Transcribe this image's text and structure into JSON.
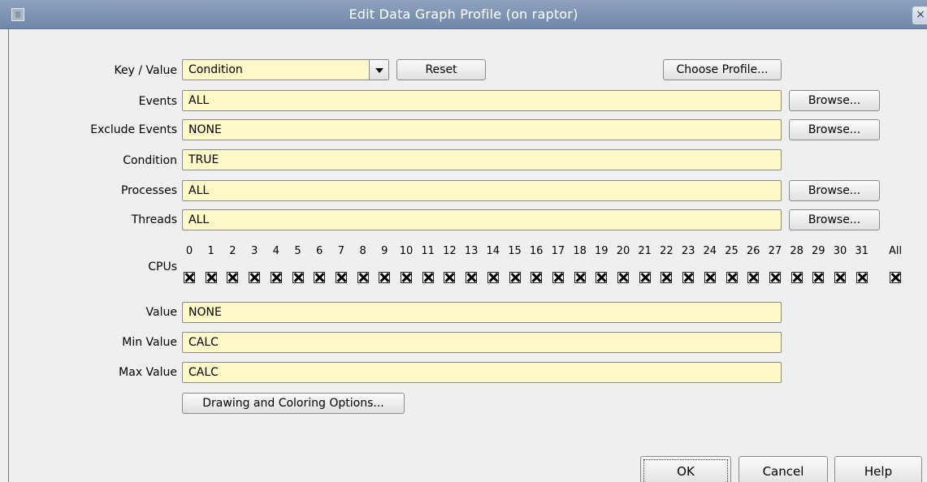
{
  "window": {
    "title": "Edit Data Graph Profile (on raptor)",
    "close_glyph": "×"
  },
  "form": {
    "key_value": {
      "label": "Key / Value",
      "selected": "Condition"
    },
    "reset_label": "Reset",
    "choose_profile_label": "Choose Profile...",
    "events": {
      "label": "Events",
      "value": "ALL",
      "browse_label": "Browse..."
    },
    "exclude_events": {
      "label": "Exclude Events",
      "value": "NONE",
      "browse_label": "Browse..."
    },
    "condition": {
      "label": "Condition",
      "value": "TRUE"
    },
    "processes": {
      "label": "Processes",
      "value": "ALL",
      "browse_label": "Browse..."
    },
    "threads": {
      "label": "Threads",
      "value": "ALL",
      "browse_label": "Browse..."
    },
    "cpus": {
      "label": "CPUs",
      "numbers": [
        "0",
        "1",
        "2",
        "3",
        "4",
        "5",
        "6",
        "7",
        "8",
        "9",
        "10",
        "11",
        "12",
        "13",
        "14",
        "15",
        "16",
        "17",
        "18",
        "19",
        "20",
        "21",
        "22",
        "23",
        "24",
        "25",
        "26",
        "27",
        "28",
        "29",
        "30",
        "31"
      ],
      "all_label": "All",
      "checked": true
    },
    "value": {
      "label": "Value",
      "value": "NONE"
    },
    "min_value": {
      "label": "Min Value",
      "value": "CALC"
    },
    "max_value": {
      "label": "Max Value",
      "value": "CALC"
    },
    "drawing_options_label": "Drawing and Coloring Options..."
  },
  "footer": {
    "ok_label": "OK",
    "cancel_label": "Cancel",
    "help_label": "Help"
  },
  "colors": {
    "field_bg": "#fff8c8",
    "title_bar": "#7a90b2",
    "dialog_bg": "#efefef"
  }
}
